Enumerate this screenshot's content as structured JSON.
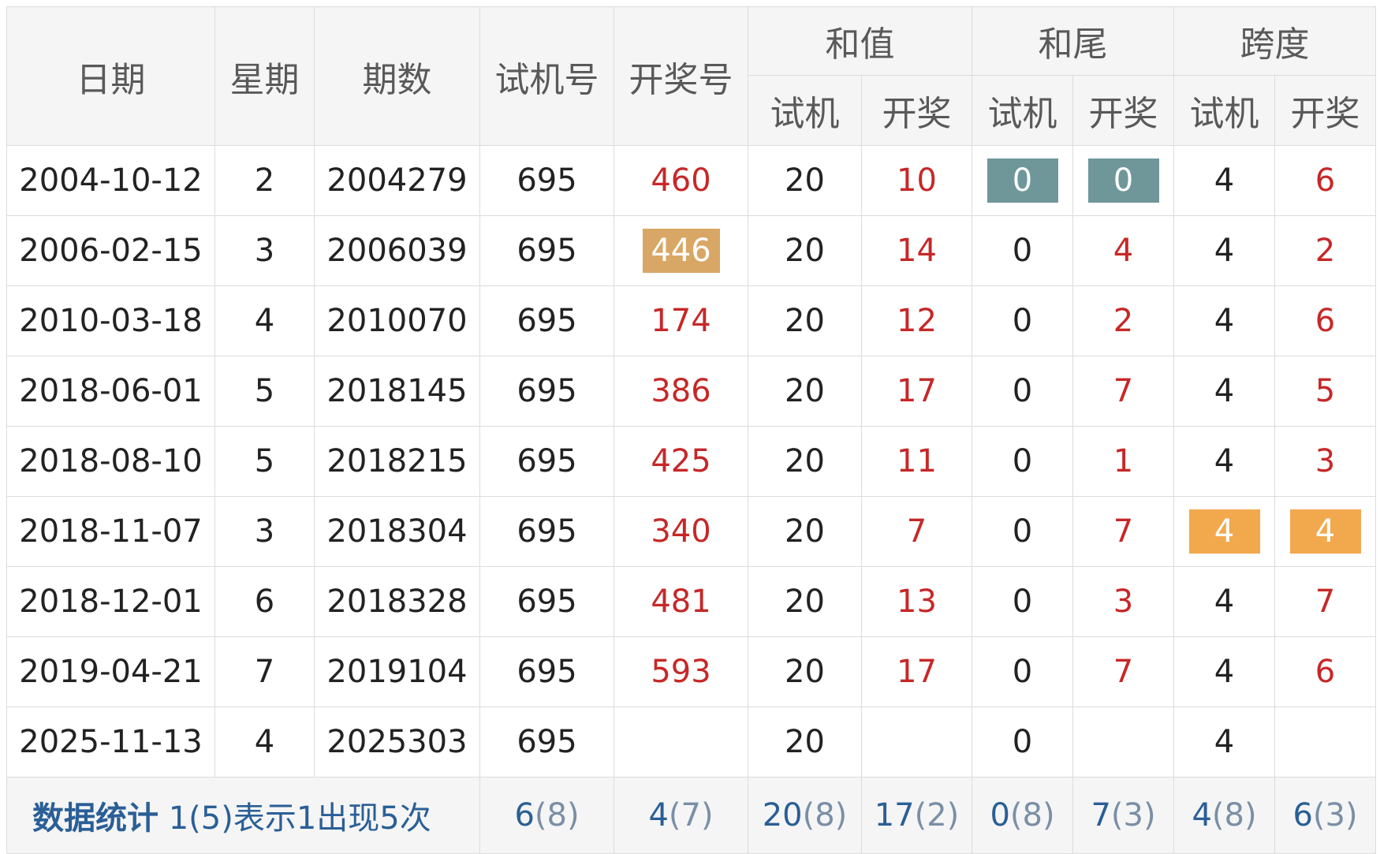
{
  "header": {
    "date": "日期",
    "weekday": "星期",
    "issue": "期数",
    "test_number": "试机号",
    "draw_number": "开奖号",
    "sum_group": "和值",
    "tail_group": "和尾",
    "span_group": "跨度",
    "sub_test": "试机",
    "sub_draw": "开奖"
  },
  "rows": [
    {
      "date": "2004-10-12",
      "weekday": "2",
      "issue": "2004279",
      "test": "695",
      "draw": "460",
      "sum_test": "20",
      "sum_draw": "10",
      "tail_test": "0",
      "tail_draw": "0",
      "span_test": "4",
      "span_draw": "6"
    },
    {
      "date": "2006-02-15",
      "weekday": "3",
      "issue": "2006039",
      "test": "695",
      "draw": "446",
      "sum_test": "20",
      "sum_draw": "14",
      "tail_test": "0",
      "tail_draw": "4",
      "span_test": "4",
      "span_draw": "2"
    },
    {
      "date": "2010-03-18",
      "weekday": "4",
      "issue": "2010070",
      "test": "695",
      "draw": "174",
      "sum_test": "20",
      "sum_draw": "12",
      "tail_test": "0",
      "tail_draw": "2",
      "span_test": "4",
      "span_draw": "6"
    },
    {
      "date": "2018-06-01",
      "weekday": "5",
      "issue": "2018145",
      "test": "695",
      "draw": "386",
      "sum_test": "20",
      "sum_draw": "17",
      "tail_test": "0",
      "tail_draw": "7",
      "span_test": "4",
      "span_draw": "5"
    },
    {
      "date": "2018-08-10",
      "weekday": "5",
      "issue": "2018215",
      "test": "695",
      "draw": "425",
      "sum_test": "20",
      "sum_draw": "11",
      "tail_test": "0",
      "tail_draw": "1",
      "span_test": "4",
      "span_draw": "3"
    },
    {
      "date": "2018-11-07",
      "weekday": "3",
      "issue": "2018304",
      "test": "695",
      "draw": "340",
      "sum_test": "20",
      "sum_draw": "7",
      "tail_test": "0",
      "tail_draw": "7",
      "span_test": "4",
      "span_draw": "4"
    },
    {
      "date": "2018-12-01",
      "weekday": "6",
      "issue": "2018328",
      "test": "695",
      "draw": "481",
      "sum_test": "20",
      "sum_draw": "13",
      "tail_test": "0",
      "tail_draw": "3",
      "span_test": "4",
      "span_draw": "7"
    },
    {
      "date": "2019-04-21",
      "weekday": "7",
      "issue": "2019104",
      "test": "695",
      "draw": "593",
      "sum_test": "20",
      "sum_draw": "17",
      "tail_test": "0",
      "tail_draw": "7",
      "span_test": "4",
      "span_draw": "6"
    },
    {
      "date": "2025-11-13",
      "weekday": "4",
      "issue": "2025303",
      "test": "695",
      "draw": "",
      "sum_test": "20",
      "sum_draw": "",
      "tail_test": "0",
      "tail_draw": "",
      "span_test": "4",
      "span_draw": ""
    }
  ],
  "footer": {
    "label": "数据统计",
    "note": "1(5)表示1出现5次",
    "test_number": {
      "value": "6",
      "count": "(8)"
    },
    "draw_number": {
      "value": "4",
      "count": "(7)"
    },
    "sum_test": {
      "value": "20",
      "count": "(8)"
    },
    "sum_draw": {
      "value": "17",
      "count": "(2)"
    },
    "tail_test": {
      "value": "0",
      "count": "(8)"
    },
    "tail_draw": {
      "value": "7",
      "count": "(3)"
    },
    "span_test": {
      "value": "4",
      "count": "(8)"
    },
    "span_draw": {
      "value": "6",
      "count": "(3)"
    }
  },
  "colors": {
    "draw_text": "#c62828",
    "footer_text": "#2a5f96",
    "highlight_teal": "#6f979a",
    "highlight_gold": "#d9a765",
    "highlight_orange": "#f2a94d"
  }
}
